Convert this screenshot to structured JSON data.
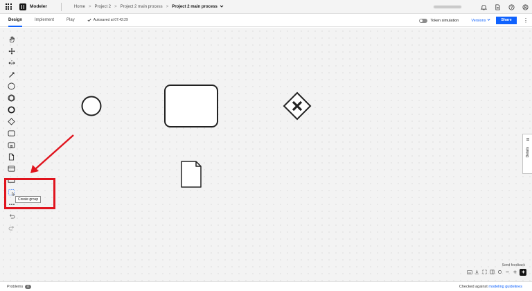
{
  "topbar": {
    "app_name": "Modeler",
    "breadcrumbs": [
      "Home",
      "Project 2",
      "Project 2 main process"
    ],
    "current": "Project 2 main process",
    "separator": ">"
  },
  "subbar": {
    "tabs": [
      "Design",
      "Implement",
      "Play"
    ],
    "active_tab": "Design",
    "autosave": "Autosaved at 07:42:29",
    "token_simulation": "Token simulation",
    "versions": "Versions",
    "share": "Share"
  },
  "palette": {
    "tooltip": "Create group"
  },
  "canvas": {
    "details_label": "Details",
    "send_feedback": "Send feedback"
  },
  "bottombar": {
    "problems_label": "Problems",
    "problems_count": "0",
    "checked_prefix": "Checked against",
    "checked_link": "modeling guidelines"
  },
  "colors": {
    "accent": "#0f62fe",
    "highlight": "#e0141e"
  },
  "icons": [
    "grid-icon",
    "bell-icon",
    "document-icon",
    "help-icon",
    "user-icon",
    "checkmark-icon",
    "hand-tool-icon",
    "lasso-tool-icon",
    "space-tool-icon",
    "connect-tool-icon",
    "start-event-icon",
    "intermediate-event-icon",
    "end-event-icon",
    "gateway-icon",
    "task-icon",
    "subprocess-icon",
    "data-object-icon",
    "data-store-icon",
    "pool-icon",
    "group-icon",
    "more-icon",
    "undo-icon",
    "redo-icon",
    "keyboard-icon",
    "download-icon",
    "fullscreen-icon",
    "minimap-icon",
    "reset-zoom-icon",
    "zoom-out-icon",
    "zoom-in-icon",
    "ai-icon"
  ]
}
